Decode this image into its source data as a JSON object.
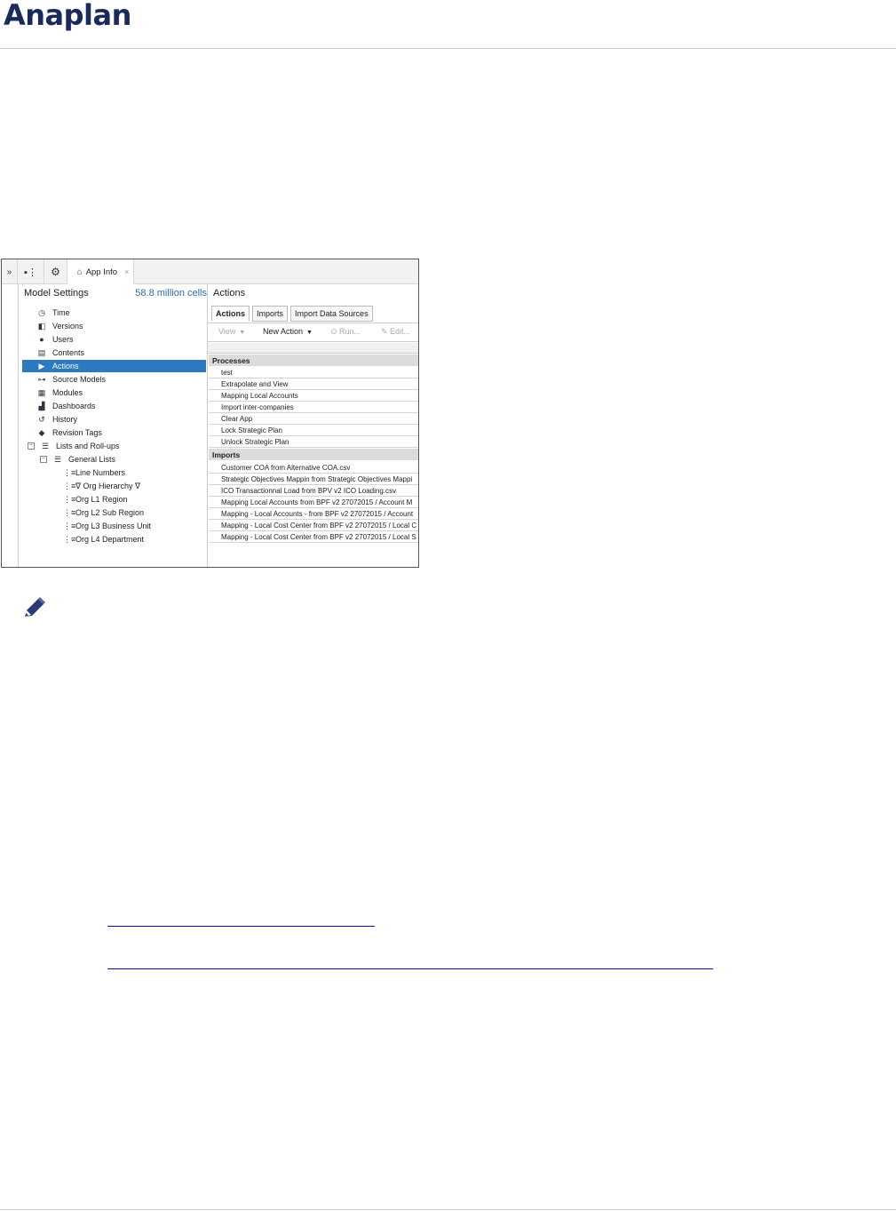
{
  "brand": {
    "logo_text": "Anaplan"
  },
  "screenshot": {
    "topbar": {
      "tab_label": "App Info",
      "close_glyph": "×"
    },
    "left_pane": {
      "title": "Model Settings",
      "cells": "58.8 million cells",
      "items": [
        {
          "label": "Time",
          "icon": "clock-icon"
        },
        {
          "label": "Versions",
          "icon": "versions-icon"
        },
        {
          "label": "Users",
          "icon": "user-icon"
        },
        {
          "label": "Contents",
          "icon": "contents-icon"
        },
        {
          "label": "Actions",
          "icon": "play-icon",
          "selected": true
        },
        {
          "label": "Source Models",
          "icon": "source-models-icon"
        },
        {
          "label": "Modules",
          "icon": "grid-icon"
        },
        {
          "label": "Dashboards",
          "icon": "dashboard-icon"
        },
        {
          "label": "History",
          "icon": "history-icon"
        },
        {
          "label": "Revision Tags",
          "icon": "tag-icon"
        },
        {
          "label": "Lists and Roll-ups",
          "icon": "list-icon"
        },
        {
          "label": "General Lists",
          "icon": "list-icon"
        },
        {
          "label": "Line Numbers",
          "icon": "list-icon"
        },
        {
          "label": "∇ Org Hierarchy ∇",
          "icon": "list-icon"
        },
        {
          "label": "Org L1 Region",
          "icon": "list-icon"
        },
        {
          "label": "Org L2 Sub Region",
          "icon": "list-icon"
        },
        {
          "label": "Org L3 Business Unit",
          "icon": "list-icon"
        },
        {
          "label": "Org L4 Department",
          "icon": "list-icon"
        }
      ]
    },
    "right_pane": {
      "title": "Actions",
      "tabs": [
        "Actions",
        "Imports",
        "Import Data Sources"
      ],
      "toolbar": {
        "view": "View",
        "new_action": "New Action",
        "run": "Run...",
        "edit": "Edit..."
      },
      "groups": [
        {
          "name": "Processes",
          "rows": [
            "test",
            "Extrapolate and View",
            "Mapping Local Accounts",
            "Import inter-companies",
            "Clear App",
            "Lock Strategic Plan",
            "Unlock Strategic Plan"
          ]
        },
        {
          "name": "Imports",
          "rows": [
            "Customer COA from Alternative COA.csv",
            "Strategic Objectives Mappin from Strategic Objectives Mappi",
            "ICO Transactionnal Load from BPV v2 ICO Loading.csv",
            "Mapping Local Accounts from BPF v2 27072015 / Account M",
            "Mapping - Local Accounts - from BPF v2 27072015 / Account",
            "Mapping - Local Cost Center from BPF v2 27072015 / Local C",
            "Mapping - Local Cost Center from BPF v2 27072015 / Local S"
          ]
        }
      ]
    }
  },
  "colors": {
    "brand": "#1b2a5c",
    "accent": "#2e7ac0",
    "link": "#1a0dab"
  }
}
